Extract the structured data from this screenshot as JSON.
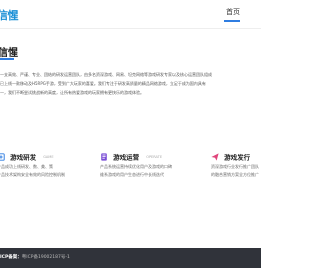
{
  "header": {
    "logo_text": "信惺",
    "nav_home": "首页"
  },
  "about": {
    "title": "信惺",
    "lines": [
      "一支高效、严谨、专业、团结的研发运营团队，由多名资深游戏、网易、坦克网络等游戏研发专家以及核心运营团队组成",
      "已上线一款移动及H5RPG手游，受到广大玩家的喜爱。我们专注于研发高质量的精品网络游戏，立足于成为国内具有",
      "一，我们不断尝试挑战新的高度，让所有热爱游戏的玩家拥有更快乐的游戏体验。"
    ]
  },
  "cards": [
    {
      "title": "游戏研发",
      "subtitle": "GAME",
      "desc": [
        "产品成功上线研发、数、美、策",
        "产品技术架构安全有效的风险控制机制"
      ],
      "color": "#2f7de1"
    },
    {
      "title": "游戏运营",
      "subtitle": "OPERATE",
      "desc": [
        "产品系统运营持续优化用户及游戏的口碑",
        "维系游戏的用户生态进行中长线迭代"
      ],
      "color": "#7b4fd6"
    },
    {
      "title": "游戏发行",
      "subtitle": "",
      "desc": [
        "资深游戏行业发行推广团队",
        "的融合营销方案全方位推广"
      ],
      "color": "#e0457b"
    }
  ],
  "footer": {
    "label": "ICP备案：",
    "icp": "粤ICP备19002187号-1"
  }
}
